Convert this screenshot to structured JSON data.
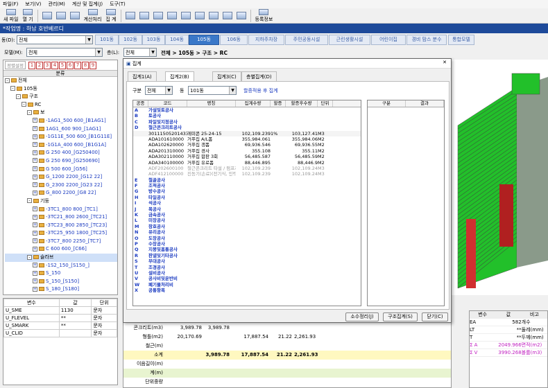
{
  "menu": [
    "파일(F)",
    "보기(V)",
    "관리(M)",
    "계산 및 집계(J)",
    "도구(T)"
  ],
  "toolbar": [
    "새 파일",
    "열 기",
    "",
    "",
    "",
    "계산처리",
    "집 계",
    "",
    "",
    "",
    "",
    "",
    "",
    "",
    "",
    "",
    "등록정보"
  ],
  "title": "*작업명 : 하남 호반베르디",
  "dong_label": "동(D):",
  "dong_value": "전체",
  "tabs": [
    "101동",
    "102동",
    "103동",
    "104동",
    "105동",
    "106동",
    "지하주차장",
    "주민공동시설",
    "근린생활시설",
    "어린이집",
    "경비 맘스 분수",
    "통합모델"
  ],
  "model_label": "모델(M):",
  "model_value": "전체",
  "floor_label": "층(L):",
  "floor_value": "전체",
  "path": "전체 > 105동 > 구조 > RC",
  "left": {
    "btn": "정렬설정",
    "nums": [
      "1",
      "2",
      "3",
      "4",
      "5",
      "6",
      "7",
      "8",
      "9"
    ],
    "header": "분류",
    "tree": [
      {
        "t": "전체",
        "d": 0,
        "b": 0,
        "f": 1,
        "s": "-"
      },
      {
        "t": "105동",
        "d": 1,
        "b": 0,
        "f": 1,
        "s": "-"
      },
      {
        "t": "구조",
        "d": 2,
        "b": 0,
        "f": 1,
        "s": "-"
      },
      {
        "t": "RC",
        "d": 3,
        "b": 0,
        "f": 1,
        "s": "-"
      },
      {
        "t": "보",
        "d": 4,
        "b": 0,
        "f": 1,
        "s": "-"
      },
      {
        "t": "-1AG1_500 600_[B1AG1]",
        "d": 5,
        "b": 1,
        "f": 1,
        "s": "+"
      },
      {
        "t": "1AG1_600 900_[1AG1]",
        "d": 5,
        "b": 1,
        "f": 1,
        "s": "+"
      },
      {
        "t": "-1G11E_500 600_[B1G11E]",
        "d": 5,
        "b": 1,
        "f": 1,
        "s": "+"
      },
      {
        "t": "-1G1A_400 600_[B1G1A]",
        "d": 5,
        "b": 1,
        "f": 1,
        "s": "+"
      },
      {
        "t": "G 250 400_[G250400]",
        "d": 5,
        "b": 1,
        "f": 1,
        "s": "+"
      },
      {
        "t": "G 250 690_[G250690]",
        "d": 5,
        "b": 1,
        "f": 1,
        "s": "+"
      },
      {
        "t": "G 500 600_[G56]",
        "d": 5,
        "b": 1,
        "f": 1,
        "s": "+"
      },
      {
        "t": "G_1200 2200_[G12 22]",
        "d": 5,
        "b": 1,
        "f": 1,
        "s": "+"
      },
      {
        "t": "G_2300 2200_[G23 22]",
        "d": 5,
        "b": 1,
        "f": 1,
        "s": "+"
      },
      {
        "t": "G_800 2200_[G8 22]",
        "d": 5,
        "b": 1,
        "f": 1,
        "s": "+"
      },
      {
        "t": "기둥",
        "d": 4,
        "b": 0,
        "f": 1,
        "s": "-"
      },
      {
        "t": "-3TC1_800 800_[TC1]",
        "d": 5,
        "b": 1,
        "f": 1,
        "s": "+"
      },
      {
        "t": "-3TC21_800 2600_[TC21]",
        "d": 5,
        "b": 1,
        "f": 1,
        "s": "+"
      },
      {
        "t": "-3TC23_800 2850_[TC23]",
        "d": 5,
        "b": 1,
        "f": 1,
        "s": "+"
      },
      {
        "t": "-3TC25_950 1800_[TC25]",
        "d": 5,
        "b": 1,
        "f": 1,
        "s": "+"
      },
      {
        "t": "-3TC7_800 2250_[TC7]",
        "d": 5,
        "b": 1,
        "f": 1,
        "s": "+"
      },
      {
        "t": "C 600 600_[C66]",
        "d": 5,
        "b": 1,
        "f": 1,
        "s": "+"
      },
      {
        "t": "슬라브",
        "d": 4,
        "b": 0,
        "f": 1,
        "s": "-",
        "sel": 1
      },
      {
        "t": "-1S2_150_[S150_]",
        "d": 5,
        "b": 1,
        "f": 1,
        "s": "+"
      },
      {
        "t": "S_150",
        "d": 5,
        "b": 1,
        "f": 1,
        "s": "+"
      },
      {
        "t": "S_150_[S150]",
        "d": 5,
        "b": 1,
        "f": 1,
        "s": "+"
      },
      {
        "t": "S_180_[S180]",
        "d": 5,
        "b": 1,
        "f": 1,
        "s": "+"
      },
      {
        "t": "S_200_[S200]",
        "d": 5,
        "b": 1,
        "f": 1,
        "s": "+"
      }
    ]
  },
  "props": {
    "headers": [
      "변수",
      "값",
      "단위"
    ],
    "rows": [
      [
        "U_SME",
        "1130",
        "문자"
      ],
      [
        "U_FLEVEL",
        "**",
        "문자"
      ],
      [
        "U_SMARK",
        "**",
        "문자"
      ],
      [
        "U_CLID",
        "",
        "문자"
      ]
    ]
  },
  "dialog": {
    "title": "집계",
    "tabs": [
      "집계1(A)",
      "집계2(B)",
      "집계3(C)",
      "층별집계(D)"
    ],
    "gubun_label": "구분",
    "gubun_value": "전체",
    "dong_label": "동",
    "dong_value": "101동",
    "link": "할증적용 후 집계",
    "headers": [
      "공종",
      "코드",
      "명칭",
      "집계수량",
      "할증",
      "할증후수량",
      "단위"
    ],
    "rows": [
      {
        "c": "A",
        "n": "가설및토공사",
        "t": 1
      },
      {
        "c": "B",
        "n": "토공사",
        "t": 1
      },
      {
        "c": "C",
        "n": "파일및지정공사",
        "t": 1
      },
      {
        "c": "D",
        "n": "철근콘크리트공사",
        "t": 1
      },
      {
        "code": "3011150520143300",
        "name": "레미콘 25-24-15",
        "q": "102,109.239",
        "h": "1%",
        "qa": "103,127.41",
        "u": "M3"
      },
      {
        "code": "ADA101610000",
        "name": "거푸집 A/L폼",
        "q": "355,984.061",
        "qa": "355,984.06",
        "u": "M2"
      },
      {
        "code": "ADA102620000",
        "name": "거푸집 갱폼",
        "q": "69,936.546",
        "qa": "69,936.55",
        "u": "M2"
      },
      {
        "code": "ADA201310000",
        "name": "거푸집 경사",
        "q": "355.108",
        "qa": "355.11",
        "u": "M2"
      },
      {
        "code": "ADA302110000",
        "name": "거푸집 합판 3회",
        "q": "56,485.587",
        "qa": "56,485.59",
        "u": "M2"
      },
      {
        "code": "ADA340100000",
        "name": "거푸집 유로폼",
        "q": "88,446.895",
        "qa": "88,446.9",
        "u": "M2"
      },
      {
        "code": "ADF202600100",
        "name": "철근콘크리트 타설 / 펌프차(21m)",
        "q": "102,109.239",
        "qa": "102,109.24",
        "u": "M3",
        "g": 1
      },
      {
        "code": "ADF412100000",
        "name": "진동기(손료)(전기식, 인력 무) D45mm",
        "q": "102,109.239",
        "qa": "102,109.24",
        "u": "M3",
        "g": 1
      },
      {
        "c": "E",
        "n": "철골공사",
        "t": 1
      },
      {
        "c": "F",
        "n": "조적공사",
        "t": 1
      },
      {
        "c": "G",
        "n": "방수공사",
        "t": 1
      },
      {
        "c": "H",
        "n": "타일공사",
        "t": 1
      },
      {
        "c": "I",
        "n": "석공사",
        "t": 1
      },
      {
        "c": "J",
        "n": "목공사",
        "t": 1
      },
      {
        "c": "K",
        "n": "금속공사",
        "t": 1
      },
      {
        "c": "L",
        "n": "미장공사",
        "t": 1
      },
      {
        "c": "M",
        "n": "창호공사",
        "t": 1
      },
      {
        "c": "N",
        "n": "유리공사",
        "t": 1
      },
      {
        "c": "O",
        "n": "도장공사",
        "t": 1
      },
      {
        "c": "P",
        "n": "수장공사",
        "t": 1
      },
      {
        "c": "Q",
        "n": "지붕및홈통공사",
        "t": 1
      },
      {
        "c": "R",
        "n": "판넬및기타공사",
        "t": 1
      },
      {
        "c": "S",
        "n": "부대공사",
        "t": 1
      },
      {
        "c": "T",
        "n": "조경공사",
        "t": 1
      },
      {
        "c": "U",
        "n": "설비공사",
        "t": 1
      },
      {
        "c": "V",
        "n": "공사비및운반비",
        "t": 1
      },
      {
        "c": "W",
        "n": "폐기물처리비",
        "t": 1
      },
      {
        "c": "X",
        "n": "공통항목",
        "t": 1
      }
    ],
    "right_headers": [
      "구분",
      "결과"
    ],
    "buttons": [
      "소수정리(J)",
      "구조집계(S)",
      "닫기(C)"
    ]
  },
  "bottom": {
    "rows": [
      {
        "l": "콘크리트(m3)",
        "v": [
          "3,989.78",
          "3,989.78",
          "",
          "",
          ""
        ]
      },
      {
        "l": "형틀(m2)",
        "v": [
          "20,170.69",
          "",
          "17,887.54",
          "21.22",
          "2,261.93"
        ]
      },
      {
        "l": "철근(m)",
        "v": [
          "",
          "",
          "",
          "",
          ""
        ]
      },
      {
        "l": "소계",
        "v": [
          "",
          "3,989.78",
          "17,887.54",
          "21.22",
          "2,261.93"
        ],
        "y": 1
      },
      {
        "l": "이음길이(m)",
        "v": [
          "",
          "",
          "",
          "",
          ""
        ]
      },
      {
        "l": "계(m)",
        "v": [
          "",
          "",
          "",
          "",
          ""
        ],
        "gr": 1
      },
      {
        "l": "단위중량",
        "v": [
          "",
          "",
          "",
          "",
          ""
        ]
      }
    ]
  },
  "rtbl": {
    "headers": [
      "변수",
      "값",
      "비고"
    ],
    "rows": [
      [
        "EA",
        "582",
        "개수"
      ],
      [
        "LT",
        "**",
        "둘레(mm)"
      ],
      [
        "T",
        "**",
        "두께(mm)"
      ],
      [
        "Σ A",
        "2049.966",
        "면적(m2)"
      ],
      [
        "Σ V",
        "3990.268",
        "볼륨(m3)"
      ]
    ]
  },
  "colors": {
    "accent": "#1e4a9a",
    "tab_selected": "#3a78c8",
    "tree_blue": "#1a3ac0",
    "building_green": "#22c02a"
  }
}
